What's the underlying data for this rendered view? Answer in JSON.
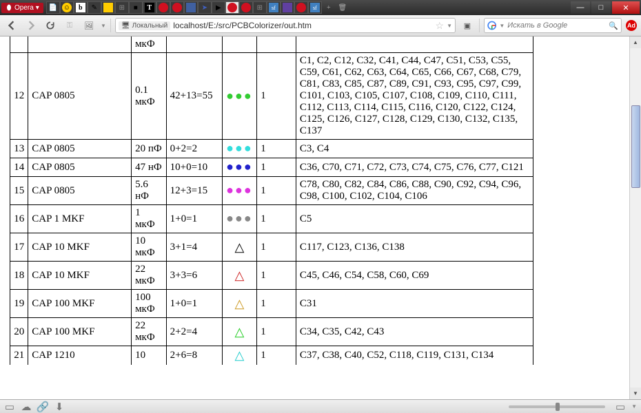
{
  "titlebar": {
    "menu_label": "Opera"
  },
  "toolbar": {
    "local_label": "Локальный",
    "url": "localhost/E:/src/PCBColorizer/out.htm",
    "search_placeholder": "Искать в Google"
  },
  "table": {
    "partial_top": {
      "value": "мкФ"
    },
    "rows": [
      {
        "n": "12",
        "type": "CAP 0805",
        "value": "0.1 мкФ",
        "count": "42+13=55",
        "sym": "dots",
        "color": "#33cc33",
        "qcol": "1",
        "refs": "C1, C2, C12, C32, C41, C44, C47, C51, C53, C55, C59, C61, C62, C63, C64, C65, C66, C67, C68, C79, C81, C83, C85, C87, C89, C91, C93, C95, C97, C99, C101, C103, C105, C107, C108, C109, C110, C111, C112, C113, C114, C115, C116, C120, C122, C124, C125, C126, C127, C128, C129, C130, C132, C135, C137"
      },
      {
        "n": "13",
        "type": "CAP 0805",
        "value": "20 пФ",
        "count": "0+2=2",
        "sym": "dots",
        "color": "#33dddd",
        "qcol": "1",
        "refs": "C3, C4"
      },
      {
        "n": "14",
        "type": "CAP 0805",
        "value": "47 нФ",
        "count": "10+0=10",
        "sym": "dots",
        "color": "#2222cc",
        "qcol": "1",
        "refs": "C36, C70, C71, C72, C73, C74, C75, C76, C77, C121"
      },
      {
        "n": "15",
        "type": "CAP 0805",
        "value": "5.6 нФ",
        "count": "12+3=15",
        "sym": "dots",
        "color": "#dd33dd",
        "qcol": "1",
        "refs": "C78, C80, C82, C84, C86, C88, C90, C92, C94, C96, C98, C100, C102, C104, C106"
      },
      {
        "n": "16",
        "type": "CAP 1 MKF",
        "value": "1 мкФ",
        "count": "1+0=1",
        "sym": "dots",
        "color": "#888888",
        "qcol": "1",
        "refs": "C5"
      },
      {
        "n": "17",
        "type": "CAP 10 MKF",
        "value": "10 мкФ",
        "count": "3+1=4",
        "sym": "tri",
        "color": "#000000",
        "qcol": "1",
        "refs": "C117, C123, C136, C138"
      },
      {
        "n": "18",
        "type": "CAP 10 MKF",
        "value": "22 мкФ",
        "count": "3+3=6",
        "sym": "tri",
        "color": "#cc2222",
        "qcol": "1",
        "refs": "C45, C46, C54, C58, C60, C69"
      },
      {
        "n": "19",
        "type": "CAP 100 MKF",
        "value": "100 мкФ",
        "count": "1+0=1",
        "sym": "tri",
        "color": "#cc9922",
        "qcol": "1",
        "refs": "C31"
      },
      {
        "n": "20",
        "type": "CAP 100 MKF",
        "value": "22 мкФ",
        "count": "2+2=4",
        "sym": "tri",
        "color": "#22cc22",
        "qcol": "1",
        "refs": "C34, C35, C42, C43"
      }
    ],
    "partial_bottom": {
      "n": "21",
      "type": "CAP 1210",
      "value": "10",
      "count": "2+6=8",
      "sym": "tri",
      "color": "#22cccc",
      "qcol": "1",
      "refs": "C37, C38, C40, C52, C118, C119, C131, C134"
    }
  }
}
